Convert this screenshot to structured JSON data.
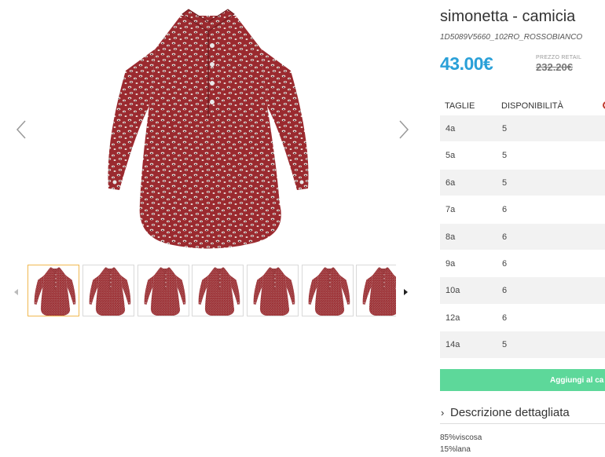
{
  "gallery": {
    "prev_icon": "chevron-left-icon",
    "next_icon": "chevron-right-icon",
    "thumb_prev_icon": "caret-left-icon",
    "thumb_next_icon": "caret-right-icon",
    "thumbnail_count": 7,
    "active_thumbnail": 1
  },
  "product": {
    "title": "simonetta - camicia",
    "sku": "1D5089V5660_102RO_ROSSOBIANCO",
    "price": "43.00€",
    "retail_label": "PREZZO RETAIL",
    "retail_price": "232.20€"
  },
  "sizes": {
    "headers": {
      "size": "TAGLIE",
      "availability": "DISPONIBILITÀ"
    },
    "rows": [
      {
        "size": "4a",
        "qty": "5"
      },
      {
        "size": "5a",
        "qty": "5"
      },
      {
        "size": "6a",
        "qty": "5"
      },
      {
        "size": "7a",
        "qty": "6"
      },
      {
        "size": "8a",
        "qty": "6"
      },
      {
        "size": "9a",
        "qty": "6"
      },
      {
        "size": "10a",
        "qty": "6"
      },
      {
        "size": "12a",
        "qty": "6"
      },
      {
        "size": "14a",
        "qty": "5"
      }
    ]
  },
  "actions": {
    "add_to_cart": "Aggiungi al ca"
  },
  "description": {
    "toggle_label": "Descrizione dettagliata",
    "composition": [
      "85%viscosa",
      "15%lana"
    ]
  },
  "colors": {
    "price": "#2aa0d8",
    "cart_button": "#5dd89a",
    "active_thumb_border": "#f0b850",
    "fabric": "#9a2a2f"
  }
}
